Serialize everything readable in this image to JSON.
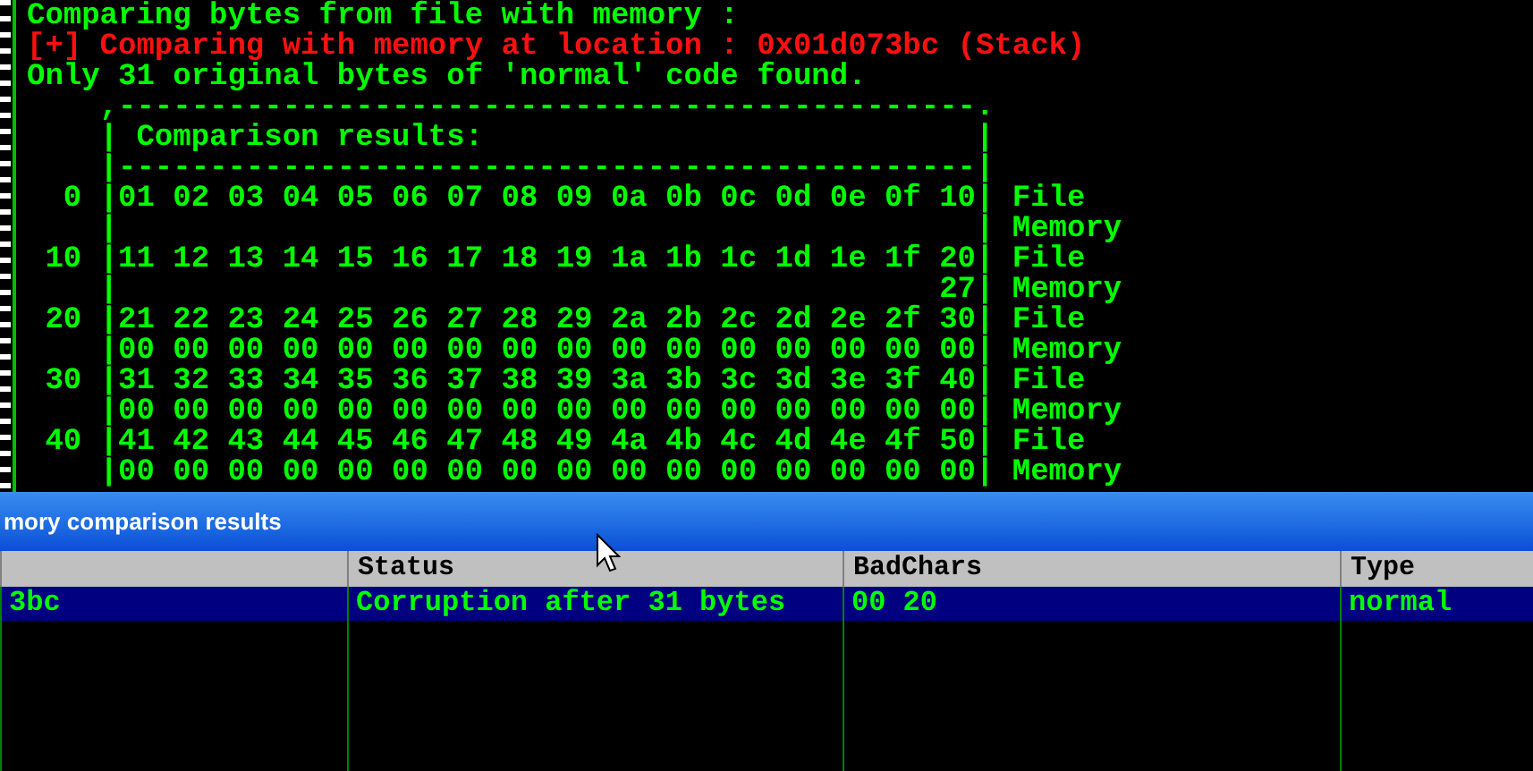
{
  "console": {
    "lines": [
      {
        "kind": "output",
        "text": "Comparing bytes from file with memory :"
      },
      {
        "kind": "notice",
        "text": "[+] Comparing with memory at location : 0x01d073bc (Stack)"
      },
      {
        "kind": "output",
        "text": "Only 31 original bytes of 'normal' code found."
      },
      {
        "kind": "output",
        "text": "    ,-----------------------------------------------."
      },
      {
        "kind": "output",
        "text": "    | Comparison results:                           |"
      },
      {
        "kind": "output",
        "text": "    |-----------------------------------------------|"
      },
      {
        "kind": "output",
        "text": "  0 |01 02 03 04 05 06 07 08 09 0a 0b 0c 0d 0e 0f 10| File"
      },
      {
        "kind": "output",
        "text": "    |                                               | Memory"
      },
      {
        "kind": "output",
        "text": " 10 |11 12 13 14 15 16 17 18 19 1a 1b 1c 1d 1e 1f 20| File"
      },
      {
        "kind": "output",
        "text": "    |                                             27| Memory"
      },
      {
        "kind": "output",
        "text": " 20 |21 22 23 24 25 26 27 28 29 2a 2b 2c 2d 2e 2f 30| File"
      },
      {
        "kind": "output",
        "text": "    |00 00 00 00 00 00 00 00 00 00 00 00 00 00 00 00| Memory"
      },
      {
        "kind": "output",
        "text": " 30 |31 32 33 34 35 36 37 38 39 3a 3b 3c 3d 3e 3f 40| File"
      },
      {
        "kind": "output",
        "text": "    |00 00 00 00 00 00 00 00 00 00 00 00 00 00 00 00| Memory"
      },
      {
        "kind": "output",
        "text": " 40 |41 42 43 44 45 46 47 48 49 4a 4b 4c 4d 4e 4f 50| File"
      },
      {
        "kind": "output",
        "text": "    |00 00 00 00 00 00 00 00 00 00 00 00 00 00 00 00| Memory"
      }
    ]
  },
  "results_window": {
    "title": "mory comparison results",
    "columns": [
      {},
      {
        "label": "Status"
      },
      {
        "label": "BadChars"
      },
      {
        "label": "Type"
      }
    ],
    "rows": [
      {
        "selected": true,
        "cells": [
          "3bc",
          "Corruption after 31 bytes",
          "00 20",
          "normal"
        ]
      }
    ]
  }
}
